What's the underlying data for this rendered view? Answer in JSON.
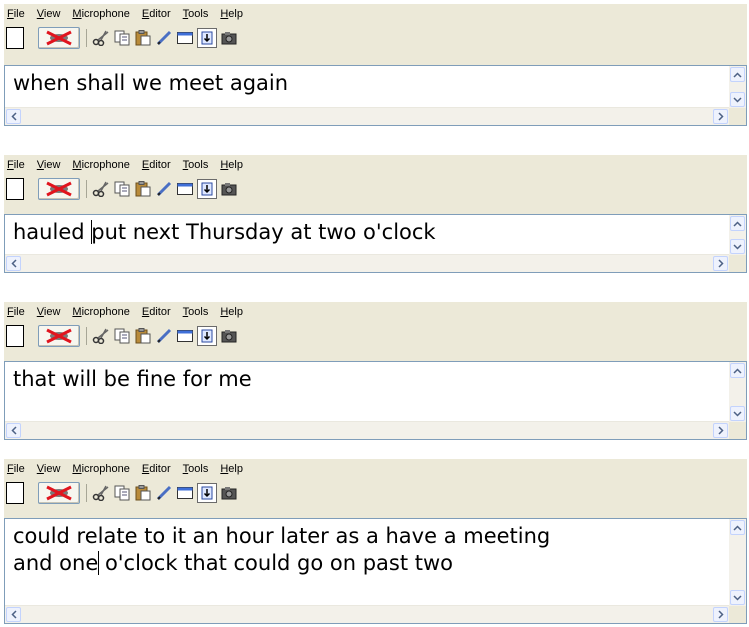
{
  "menu": [
    {
      "key": "F",
      "rest": "ile"
    },
    {
      "key": "V",
      "rest": "iew"
    },
    {
      "key": "M",
      "rest": "icrophone"
    },
    {
      "key": "E",
      "rest": "ditor"
    },
    {
      "key": "T",
      "rest": "ools"
    },
    {
      "key": "H",
      "rest": "elp"
    }
  ],
  "toolbar_icons": [
    "blank-document-icon",
    "microphone-off-icon",
    "cut-icon",
    "copy-icon",
    "paste-icon",
    "pen-icon",
    "window-icon",
    "download-icon",
    "camera-icon"
  ],
  "panels": [
    {
      "before": "when shall we meet again",
      "after": ""
    },
    {
      "before": "hauled ",
      "after": "put next Thursday at two o'clock"
    },
    {
      "before": "that will be fine for me",
      "after": ""
    },
    {
      "before": "could relate to it an hour later as a have a meeting\nand one",
      "after": " o'clock that could go on past two"
    }
  ],
  "colors": {
    "chrome": "#ece9d8",
    "mic_x": "#e0141e",
    "scroll_border": "#c3d3fd"
  }
}
